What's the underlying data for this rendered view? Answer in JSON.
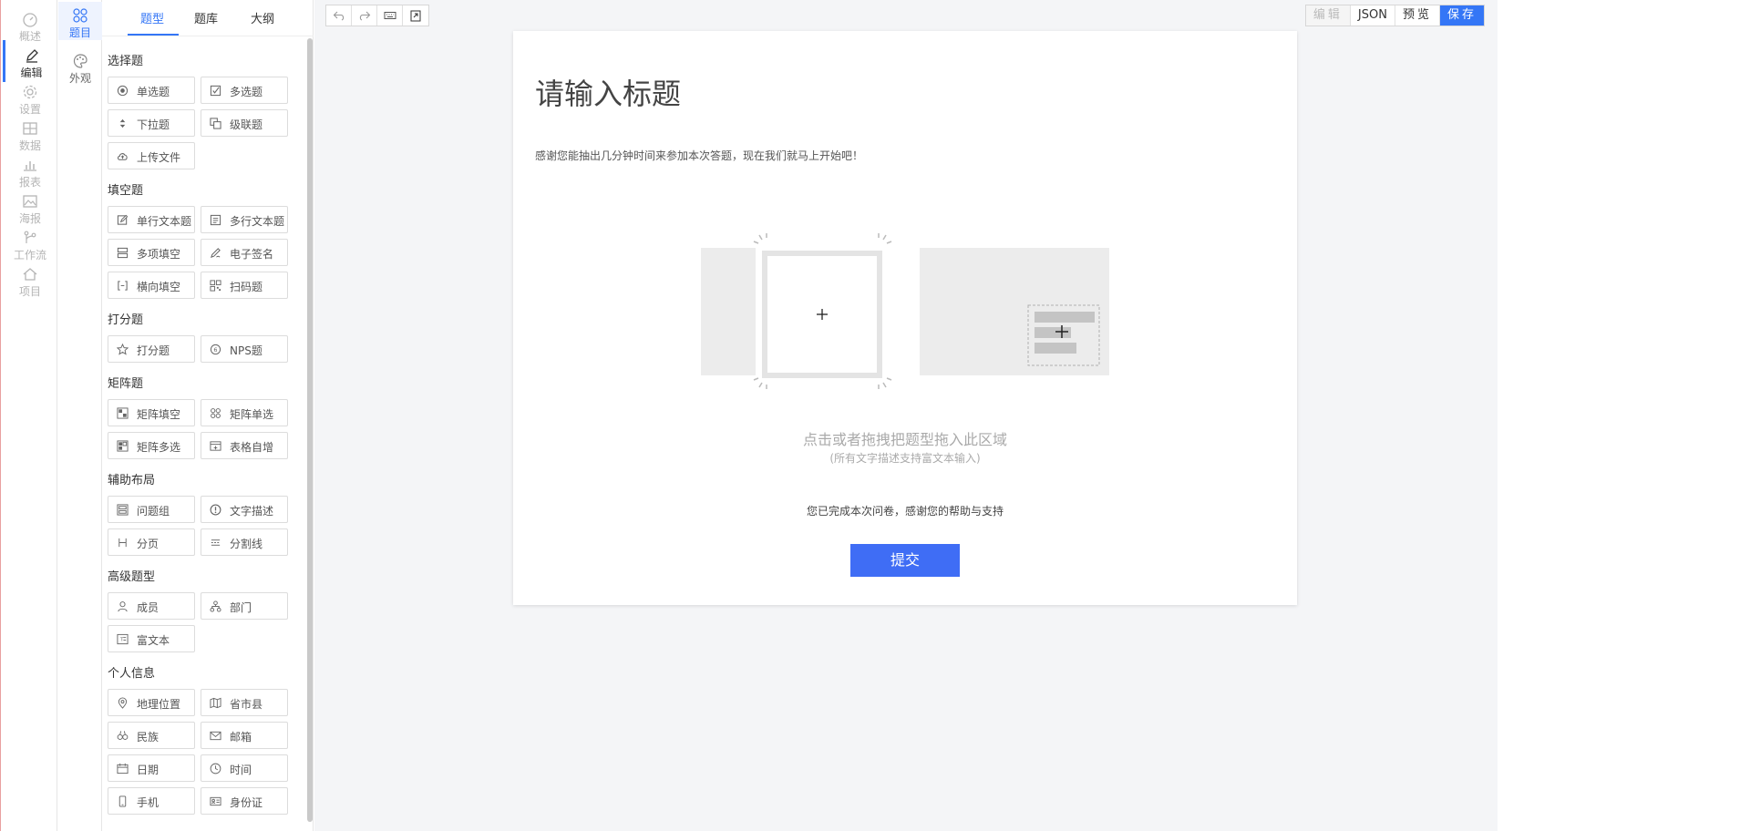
{
  "rail": [
    {
      "label": "概述",
      "icon": "dashboard-icon"
    },
    {
      "label": "编辑",
      "icon": "pencil-icon",
      "active": true
    },
    {
      "label": "设置",
      "icon": "gear-icon"
    },
    {
      "label": "数据",
      "icon": "table-icon"
    },
    {
      "label": "报表",
      "icon": "bar-chart-icon"
    },
    {
      "label": "海报",
      "icon": "image-icon"
    },
    {
      "label": "工作流",
      "icon": "workflow-icon"
    },
    {
      "label": "项目",
      "icon": "home-icon"
    }
  ],
  "rail2": [
    {
      "label": "题目",
      "icon": "grid-circles-icon",
      "active": true
    },
    {
      "label": "外观",
      "icon": "palette-icon"
    }
  ],
  "tabs": [
    "题型",
    "题库",
    "大纲"
  ],
  "sections": [
    {
      "title": "选择题",
      "items": [
        {
          "label": "单选题",
          "icon": "radio-icon"
        },
        {
          "label": "多选题",
          "icon": "checkbox-icon"
        },
        {
          "label": "下拉题",
          "icon": "dropdown-icon"
        },
        {
          "label": "级联题",
          "icon": "cascade-icon"
        },
        {
          "label": "上传文件",
          "icon": "upload-cloud-icon"
        }
      ]
    },
    {
      "title": "填空题",
      "items": [
        {
          "label": "单行文本题",
          "icon": "edit-icon"
        },
        {
          "label": "多行文本题",
          "icon": "textarea-icon"
        },
        {
          "label": "多项填空",
          "icon": "multi-fill-icon"
        },
        {
          "label": "电子签名",
          "icon": "signature-icon"
        },
        {
          "label": "横向填空",
          "icon": "bracket-icon"
        },
        {
          "label": "扫码题",
          "icon": "qrcode-icon"
        }
      ]
    },
    {
      "title": "打分题",
      "items": [
        {
          "label": "打分题",
          "icon": "star-icon"
        },
        {
          "label": "NPS题",
          "icon": "nps-icon"
        }
      ]
    },
    {
      "title": "矩阵题",
      "items": [
        {
          "label": "矩阵填空",
          "icon": "matrix-fill-icon"
        },
        {
          "label": "矩阵单选",
          "icon": "matrix-radio-icon"
        },
        {
          "label": "矩阵多选",
          "icon": "matrix-check-icon"
        },
        {
          "label": "表格自增",
          "icon": "table-add-icon"
        }
      ]
    },
    {
      "title": "辅助布局",
      "items": [
        {
          "label": "问题组",
          "icon": "group-icon"
        },
        {
          "label": "文字描述",
          "icon": "info-icon"
        },
        {
          "label": "分页",
          "icon": "page-break-icon"
        },
        {
          "label": "分割线",
          "icon": "divider-icon"
        }
      ]
    },
    {
      "title": "高级题型",
      "items": [
        {
          "label": "成员",
          "icon": "user-icon"
        },
        {
          "label": "部门",
          "icon": "org-icon"
        },
        {
          "label": "富文本",
          "icon": "richtext-icon"
        }
      ]
    },
    {
      "title": "个人信息",
      "items": [
        {
          "label": "地理位置",
          "icon": "location-icon"
        },
        {
          "label": "省市县",
          "icon": "map-icon"
        },
        {
          "label": "民族",
          "icon": "people-icon"
        },
        {
          "label": "邮箱",
          "icon": "mail-icon"
        },
        {
          "label": "日期",
          "icon": "calendar-icon"
        },
        {
          "label": "时间",
          "icon": "clock-icon"
        },
        {
          "label": "手机",
          "icon": "phone-icon"
        },
        {
          "label": "身份证",
          "icon": "idcard-icon"
        }
      ]
    }
  ],
  "toolbar": {
    "left_icons": [
      "undo-icon",
      "redo-icon",
      "keyboard-icon",
      "export-icon"
    ],
    "edit": "编辑",
    "json": "JSON",
    "preview": "预览",
    "save": "保存"
  },
  "form": {
    "title": "请输入标题",
    "description": "感谢您能抽出几分钟时间来参加本次答题，现在我们就马上开始吧！",
    "drop_hint": "点击或者拖拽把题型拖入此区域",
    "drop_sub": "(所有文字描述支持富文本输入)",
    "finish_text": "您已完成本次问卷，感谢您的帮助与支持",
    "submit": "提交"
  },
  "colors": {
    "accent": "#3476f6",
    "submit": "#3f6df5"
  }
}
